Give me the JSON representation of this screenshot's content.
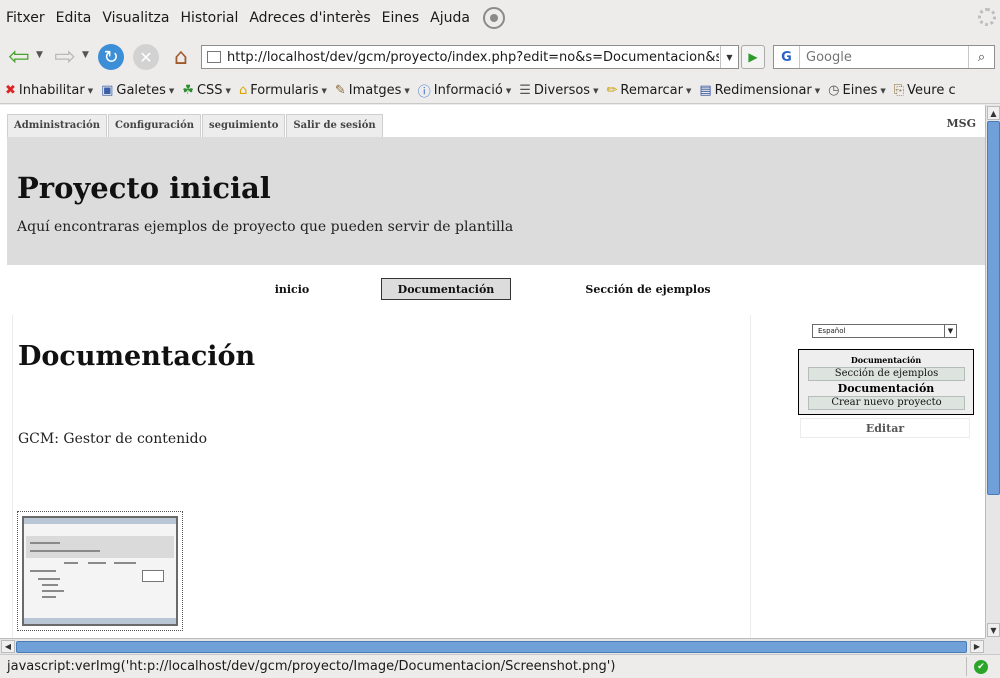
{
  "menubar": {
    "items": [
      {
        "label": "Fitxer"
      },
      {
        "label": "Edita"
      },
      {
        "label": "Visualitza"
      },
      {
        "label": "Historial"
      },
      {
        "label": "Adreces d'interès"
      },
      {
        "label": "Eines"
      },
      {
        "label": "Ajuda"
      }
    ]
  },
  "navbar": {
    "url": "http://localhost/dev/gcm/proyecto/index.php?edit=no&s=Documentacion&s=I",
    "search_placeholder": "Google",
    "search_engine": "G"
  },
  "toolbar2": {
    "items": [
      {
        "label": "Inhabilitar",
        "icon": "x-icon"
      },
      {
        "label": "Galetes",
        "icon": "cookie-icon"
      },
      {
        "label": "CSS",
        "icon": "css-icon"
      },
      {
        "label": "Formularis",
        "icon": "lock-icon"
      },
      {
        "label": "Imatges",
        "icon": "image-icon"
      },
      {
        "label": "Informació",
        "icon": "info-icon"
      },
      {
        "label": "Diversos",
        "icon": "list-icon"
      },
      {
        "label": "Remarcar",
        "icon": "pen-icon"
      },
      {
        "label": "Redimensionar",
        "icon": "window-icon"
      },
      {
        "label": "Eines",
        "icon": "clock-icon"
      },
      {
        "label": "Veure c",
        "icon": "clipboard-icon"
      }
    ]
  },
  "page": {
    "admin_tabs": [
      {
        "label": "Administración"
      },
      {
        "label": "Configuración"
      },
      {
        "label": "seguimiento"
      },
      {
        "label": "Salir de sesión"
      }
    ],
    "msg": "MSG",
    "title": "Proyecto inicial",
    "subtitle": "Aquí encontraras ejemplos de proyecto que pueden servir de plantilla",
    "nav": {
      "inicio": "inicio",
      "documentacion": "Documentación",
      "seccion": "Sección de ejemplos"
    },
    "content_title": "Documentación",
    "content_text": "GCM: Gestor de contenido",
    "language": "Español",
    "sidebox": {
      "heading1": "Documentación",
      "link1": "Sección de ejemplos",
      "heading2": "Documentación",
      "link2": "Crear nuevo proyecto"
    },
    "edit": "Editar"
  },
  "statusbar": {
    "text": "javascript:verImg('ht:p://localhost/dev/gcm/proyecto/Image/Documentacion/Screenshot.png')"
  },
  "colors": {
    "banner": "#dcdcdc",
    "scroll_thumb": "#6fa0d8",
    "chrome": "#edeceb"
  }
}
